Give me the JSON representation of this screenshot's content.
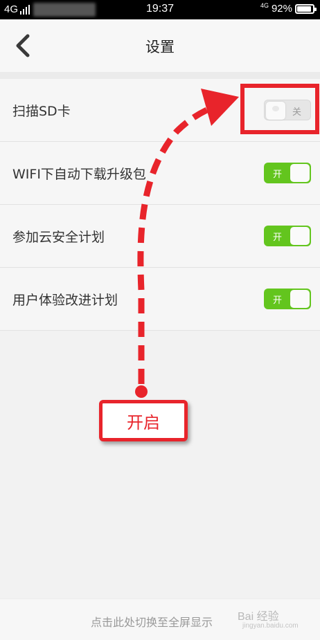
{
  "status_bar": {
    "network_left": "4G",
    "time": "19:37",
    "network_right": "4G",
    "battery": "92%",
    "battery_level": 0.92
  },
  "nav": {
    "back_icon": "chevron-left-icon",
    "title": "设置"
  },
  "settings": [
    {
      "label": "扫描SD卡",
      "state": "off",
      "toggle_text": "关"
    },
    {
      "label": "WIFI下自动下载升级包",
      "state": "on",
      "toggle_text": "开"
    },
    {
      "label": "参加云安全计划",
      "state": "on",
      "toggle_text": "开"
    },
    {
      "label": "用户体验改进计划",
      "state": "on",
      "toggle_text": "开"
    }
  ],
  "annotation": {
    "label": "开启",
    "color": "#e8242b"
  },
  "bottom": {
    "fullscreen_text": "点击此处切换至全屏显示",
    "watermark": "Bai 经验",
    "watermark_sub": "jingyan.baidu.com"
  },
  "colors": {
    "toggle_on": "#63c51e",
    "toggle_off": "#e6e6e6",
    "annotation_red": "#e8242b"
  }
}
